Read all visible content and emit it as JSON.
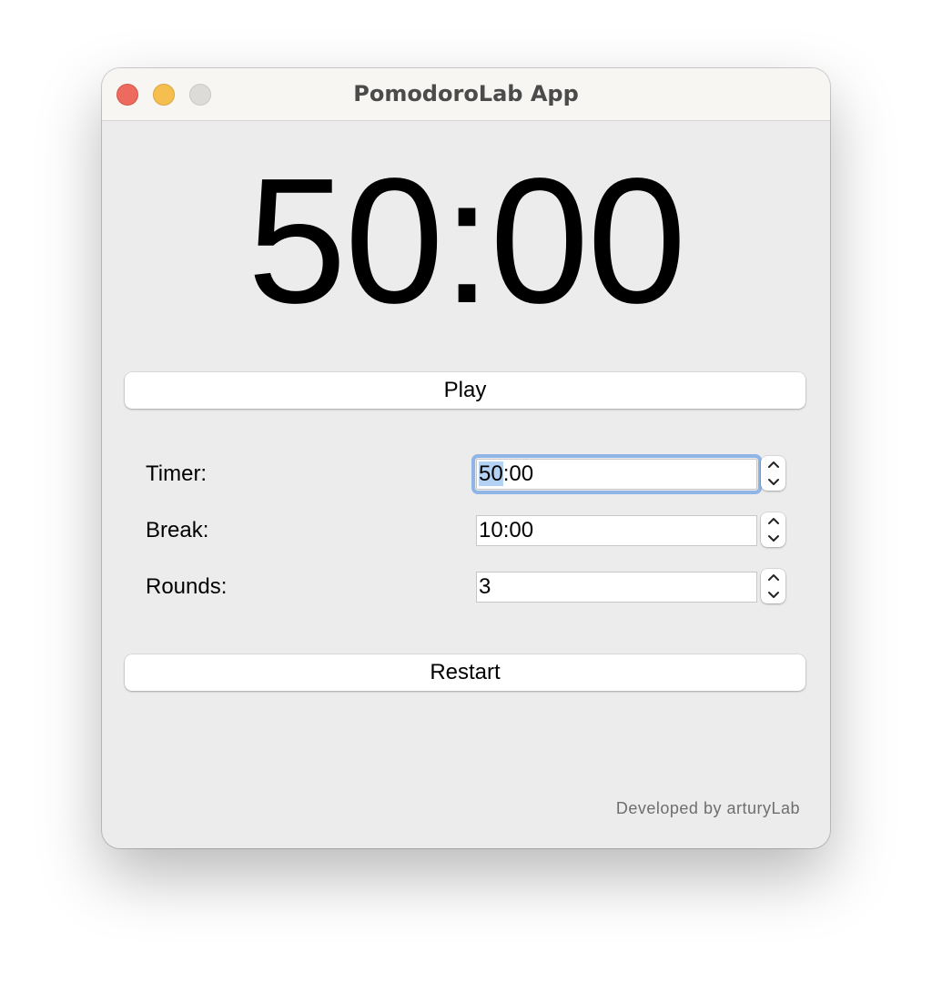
{
  "window": {
    "title": "PomodoroLab App"
  },
  "timer": {
    "display": "50:00"
  },
  "buttons": {
    "play_label": "Play",
    "restart_label": "Restart"
  },
  "settings": {
    "timer_label": "Timer:",
    "timer_value_selected": "50",
    "timer_value_rest": ":00",
    "break_label": "Break:",
    "break_value": "10:00",
    "rounds_label": "Rounds:",
    "rounds_value": "3"
  },
  "footer": {
    "credit": "Developed by arturyLab"
  },
  "icons": {
    "stepper_up": "chevron-up-icon",
    "stepper_down": "chevron-down-icon"
  },
  "colors": {
    "close": "#ec6a5e",
    "minimize": "#f4bf4f",
    "zoom": "#dcdbd7",
    "focus_ring": "#8fb4e6",
    "selection": "#b4d2f3"
  }
}
